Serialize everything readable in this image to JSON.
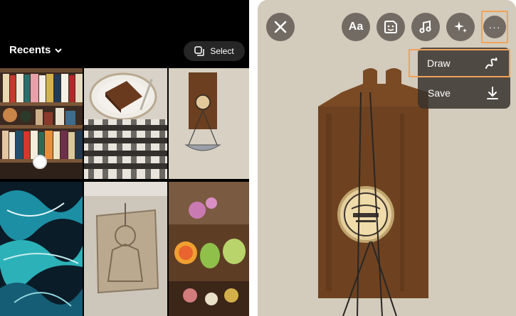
{
  "gallery": {
    "album_label": "Recents",
    "select_label": "Select",
    "photos": [
      "bookshelf-photo",
      "cake-on-plate-photo",
      "wall-hanging-photo",
      "marbled-paper-photo",
      "stone-carving-photo",
      "fruit-still-life-photo"
    ]
  },
  "editor": {
    "text_tool_label": "Aa",
    "more_label": "···",
    "menu": {
      "draw_label": "Draw",
      "save_label": "Save"
    },
    "icons": [
      "close-icon",
      "sticker-icon",
      "music-icon",
      "sparkles-icon",
      "squiggle-icon",
      "download-icon"
    ],
    "highlight_color": "#f0a35a"
  }
}
